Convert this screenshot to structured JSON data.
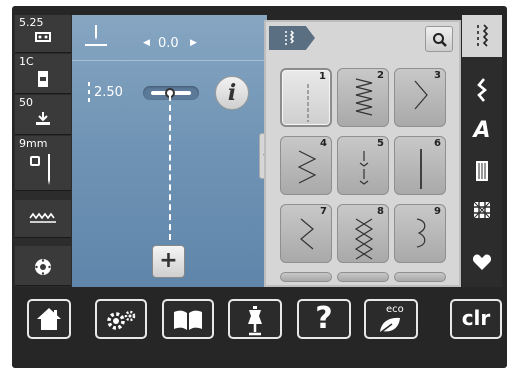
{
  "leftbar": {
    "items": [
      {
        "value": "5.25",
        "icon": "needle-plate-icon"
      },
      {
        "value": "1C",
        "icon": "presser-foot-icon"
      },
      {
        "value": "50",
        "icon": "foot-pressure-icon"
      },
      {
        "value": "9mm",
        "icon": "needle-icon"
      },
      {
        "value": "",
        "icon": "wave-feed-icon"
      },
      {
        "value": "",
        "icon": "bobbin-icon"
      }
    ]
  },
  "main": {
    "position_value": "0.0",
    "stitch_length": "2.50",
    "info_label": "i",
    "add_label": "+"
  },
  "panel": {
    "search_icon": "search-icon",
    "stitches": [
      {
        "num": "1",
        "selected": true
      },
      {
        "num": "2",
        "selected": false
      },
      {
        "num": "3",
        "selected": false
      },
      {
        "num": "4",
        "selected": false
      },
      {
        "num": "5",
        "selected": false
      },
      {
        "num": "6",
        "selected": false
      },
      {
        "num": "7",
        "selected": false
      },
      {
        "num": "8",
        "selected": false
      },
      {
        "num": "9",
        "selected": false
      }
    ]
  },
  "rightbar": {
    "items": [
      "utility-stitches-icon",
      "decorative-stitches-icon",
      "alphabet-icon",
      "buttonhole-icon",
      "quilting-icon",
      "favorites-icon"
    ],
    "alphabet_label": "A"
  },
  "bottombar": {
    "help_label": "?",
    "eco_label": "eco",
    "clr_label": "clr"
  },
  "colors": {
    "accent_blue": "#6f93b4",
    "panel_gray": "#d6d6d6",
    "bar_dark": "#262626"
  }
}
